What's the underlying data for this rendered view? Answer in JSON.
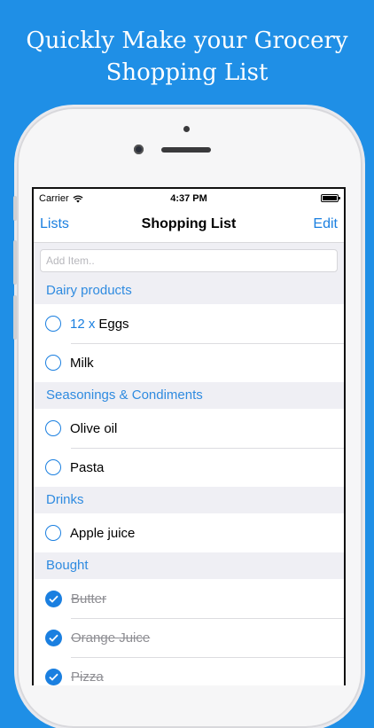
{
  "headline": {
    "line1": "Quickly Make your Grocery",
    "line2": "Shopping List"
  },
  "status_bar": {
    "carrier": "Carrier",
    "time": "4:37 PM"
  },
  "nav": {
    "left": "Lists",
    "title": "Shopping List",
    "right": "Edit"
  },
  "add_item": {
    "placeholder": "Add Item.."
  },
  "sections": [
    {
      "title": "Dairy products",
      "items": [
        {
          "qty": "12 x",
          "name": "Eggs",
          "checked": false
        },
        {
          "name": "Milk",
          "checked": false
        }
      ]
    },
    {
      "title": "Seasonings & Condiments",
      "items": [
        {
          "name": "Olive oil",
          "checked": false
        },
        {
          "name": "Pasta",
          "checked": false
        }
      ]
    },
    {
      "title": "Drinks",
      "items": [
        {
          "name": "Apple juice",
          "checked": false
        }
      ]
    },
    {
      "title": "Bought",
      "items": [
        {
          "name": "Butter",
          "checked": true
        },
        {
          "name": "Orange Juice",
          "checked": true
        },
        {
          "name": "Pizza",
          "checked": true
        }
      ]
    }
  ],
  "colors": {
    "background": "#1f8fe6",
    "accent": "#1a7fe0",
    "section_text": "#2f8be0"
  }
}
